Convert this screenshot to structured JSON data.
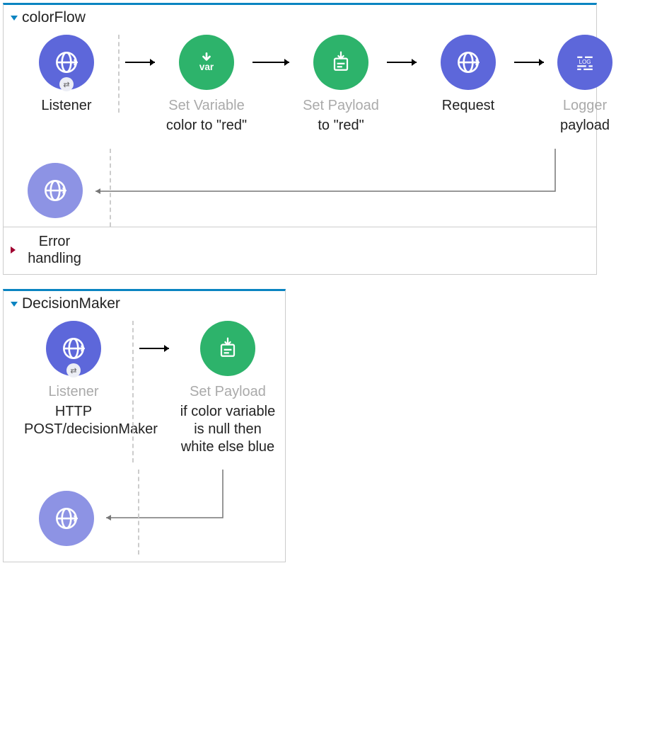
{
  "flows": [
    {
      "title": "colorFlow",
      "errorLabel": "Error handling",
      "steps": [
        {
          "name": "Listener",
          "faded": false,
          "desc": ""
        },
        {
          "name": "Set Variable",
          "faded": true,
          "desc": "color to \"red\""
        },
        {
          "name": "Set Payload",
          "faded": true,
          "desc": "to \"red\""
        },
        {
          "name": "Request",
          "faded": false,
          "desc": ""
        },
        {
          "name": "Logger",
          "faded": true,
          "desc": "payload"
        }
      ]
    },
    {
      "title": "DecisionMaker",
      "errorLabel": "",
      "steps": [
        {
          "name": "Listener",
          "faded": true,
          "desc": "HTTP POST/decisionMaker"
        },
        {
          "name": "Set Payload",
          "faded": true,
          "desc": "if color variable is null then white else blue"
        }
      ]
    }
  ]
}
